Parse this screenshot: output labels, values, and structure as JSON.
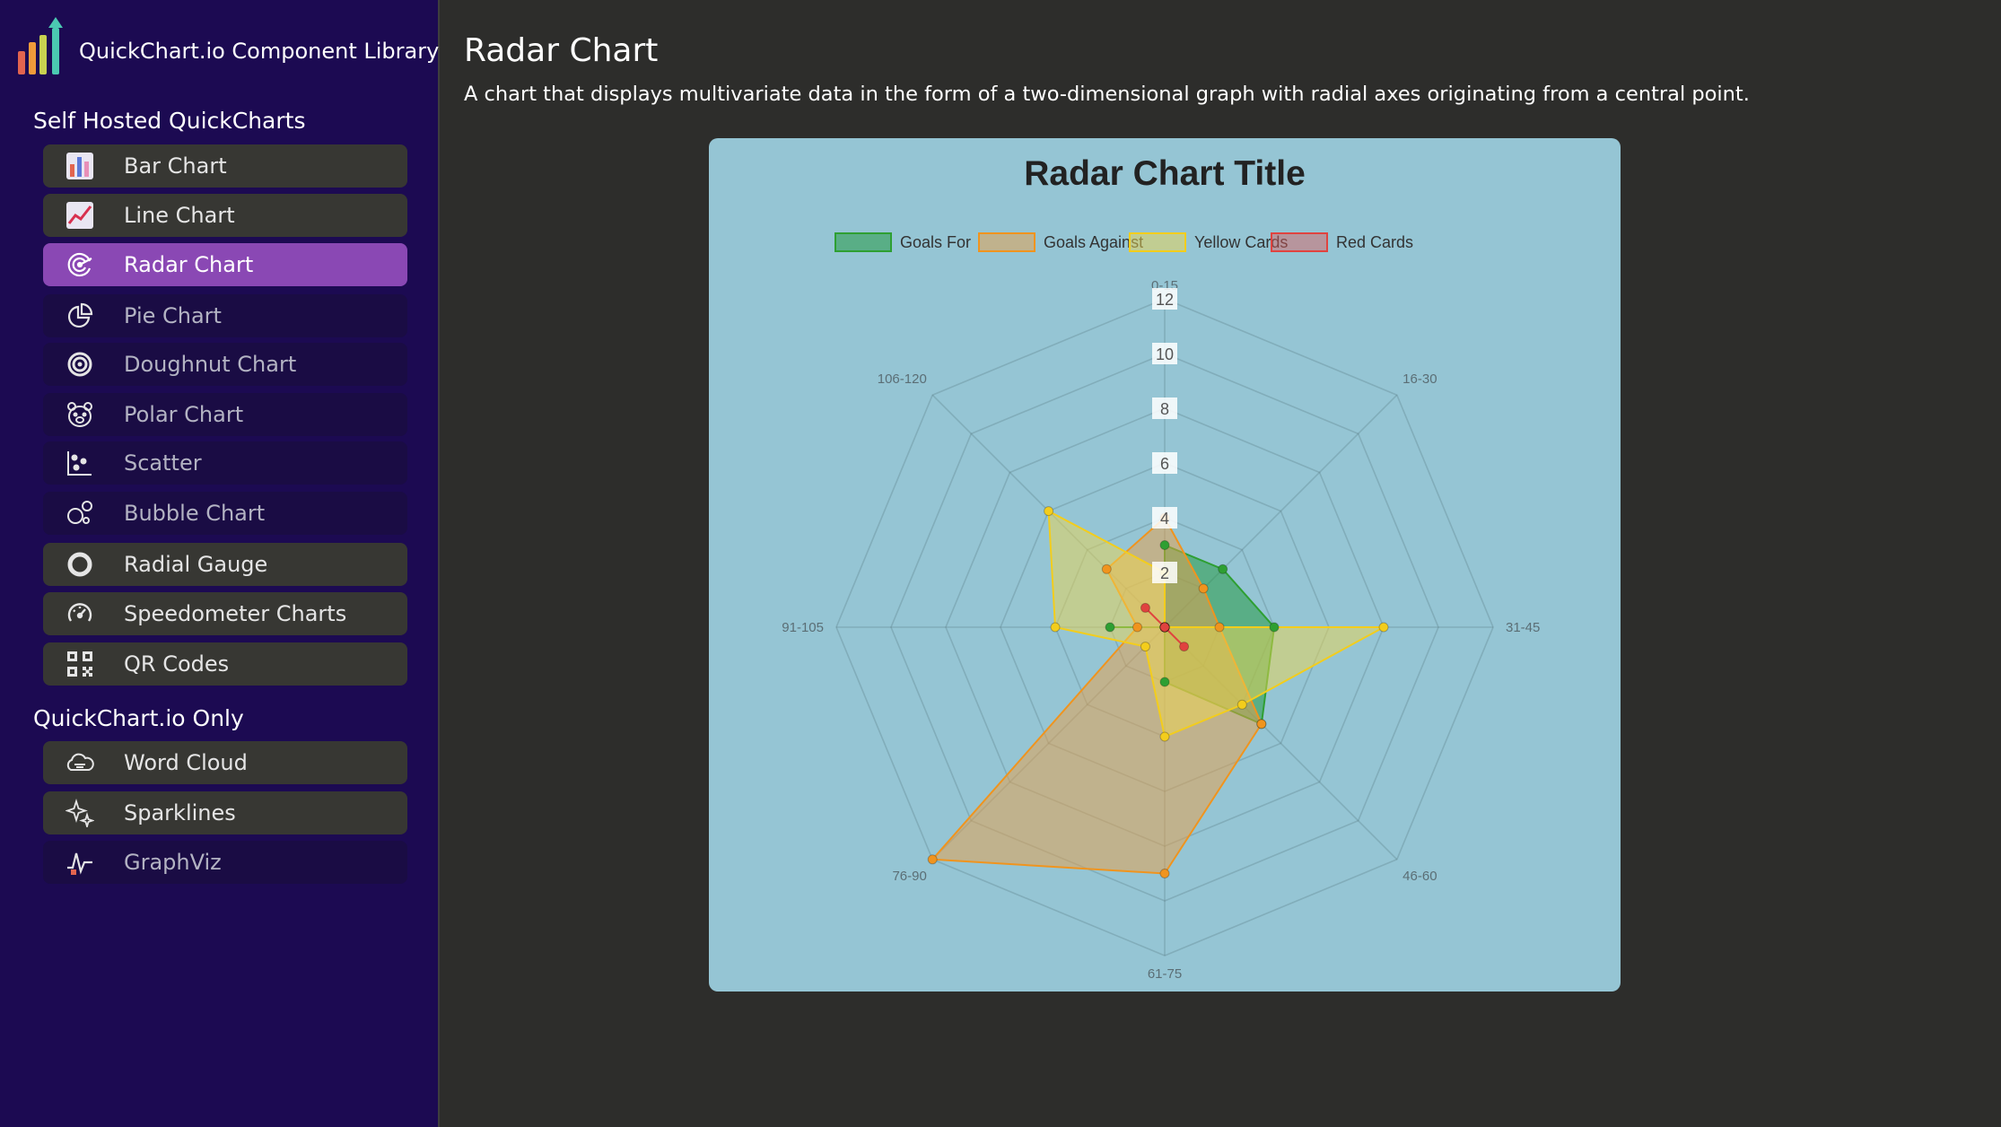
{
  "sidebar": {
    "brand": "QuickChart.io Component Library",
    "sections": [
      {
        "heading": "Self Hosted QuickCharts",
        "items": [
          {
            "label": "Bar Chart",
            "icon": "bar-chart-icon"
          },
          {
            "label": "Line Chart",
            "icon": "line-chart-icon"
          },
          {
            "label": "Radar Chart",
            "icon": "radar-chart-icon",
            "active": true
          },
          {
            "label": "Pie Chart",
            "icon": "pie-chart-icon"
          },
          {
            "label": "Doughnut Chart",
            "icon": "doughnut-chart-icon"
          },
          {
            "label": "Polar Chart",
            "icon": "polar-chart-icon"
          },
          {
            "label": "Scatter",
            "icon": "scatter-icon"
          },
          {
            "label": "Bubble Chart",
            "icon": "bubble-chart-icon"
          },
          {
            "label": "Radial Gauge",
            "icon": "radial-gauge-icon"
          },
          {
            "label": "Speedometer Charts",
            "icon": "speedometer-icon"
          },
          {
            "label": "QR Codes",
            "icon": "qr-code-icon"
          }
        ]
      },
      {
        "heading": "QuickChart.io Only",
        "items": [
          {
            "label": "Word Cloud",
            "icon": "word-cloud-icon"
          },
          {
            "label": "Sparklines",
            "icon": "sparklines-icon"
          },
          {
            "label": "GraphViz",
            "icon": "graphviz-icon"
          }
        ]
      }
    ]
  },
  "main": {
    "title": "Radar Chart",
    "description": "A chart that displays multivariate data in the form of a two-dimensional graph with radial axes originating from a central point."
  },
  "colors": {
    "sidebar_bg": "#1c0a52",
    "active_item": "#8a48b4",
    "page_bg": "#2d2d2b",
    "chart_bg": "#95c5d4"
  },
  "chart_data": {
    "type": "radar",
    "title": "Radar Chart Title",
    "labels": [
      "0-15",
      "16-30",
      "31-45",
      "46-60",
      "61-75",
      "76-90",
      "91-105",
      "106-120"
    ],
    "r_ticks": [
      2,
      4,
      6,
      8,
      10,
      12
    ],
    "r_max": 12,
    "legend_position": "top",
    "grid": true,
    "series": [
      {
        "name": "Goals For",
        "values": [
          3,
          3,
          4,
          5,
          2,
          0,
          2,
          0
        ],
        "border": "#2e9f32",
        "fill": "rgba(40,155,70,0.55)"
      },
      {
        "name": "Goals Against",
        "values": [
          4,
          2,
          2,
          5,
          9,
          12,
          1,
          3
        ],
        "border": "#f0941e",
        "fill": "rgba(236,160,70,0.5)"
      },
      {
        "name": "Yellow Cards",
        "values": [
          2,
          0,
          8,
          4,
          4,
          1,
          4,
          6
        ],
        "border": "#f3cd1c",
        "fill": "rgba(238,214,80,0.5)"
      },
      {
        "name": "Red Cards",
        "values": [
          0,
          0,
          0,
          1,
          0,
          0,
          0,
          1
        ],
        "border": "#e0433f",
        "fill": "rgba(224,90,90,0.45)"
      }
    ]
  }
}
